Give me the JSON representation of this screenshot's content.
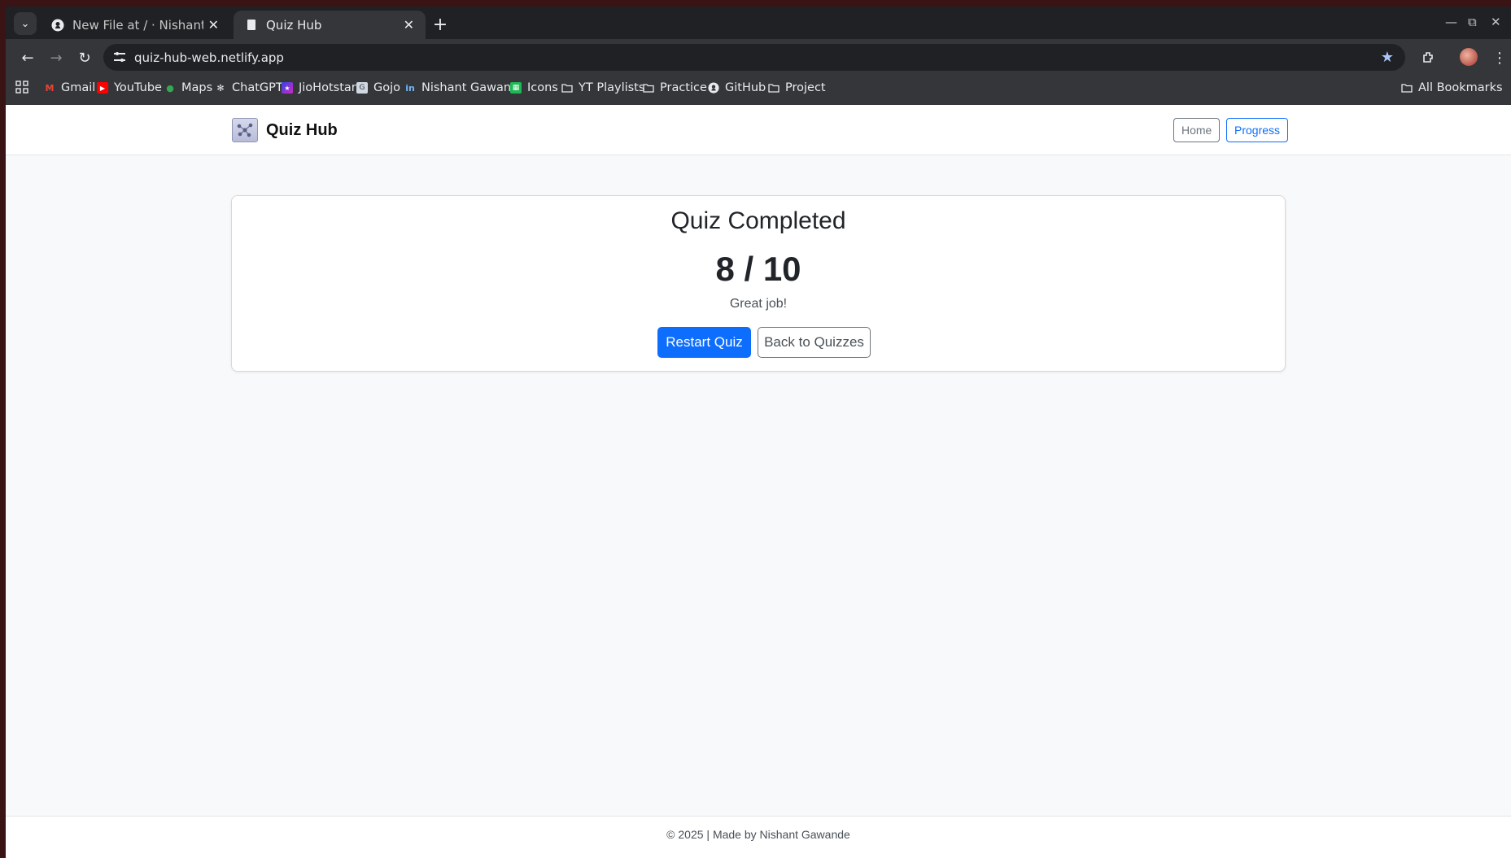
{
  "browser": {
    "tabs": [
      {
        "title": "New File at / · Nishantsg",
        "active": false
      },
      {
        "title": "Quiz Hub",
        "active": true
      }
    ],
    "url": "quiz-hub-web.netlify.app",
    "bookmarks": [
      {
        "label": "Gmail",
        "icon": "gmail-icon"
      },
      {
        "label": "YouTube",
        "icon": "youtube-icon"
      },
      {
        "label": "Maps",
        "icon": "maps-icon"
      },
      {
        "label": "ChatGPT",
        "icon": "chatgpt-icon"
      },
      {
        "label": "JioHotstar",
        "icon": "jiohotstar-icon"
      },
      {
        "label": "Gojo",
        "icon": "gojo-icon"
      },
      {
        "label": "Nishant Gawan...",
        "icon": "linkedin-icon"
      },
      {
        "label": "Icons",
        "icon": "icons-app-icon"
      },
      {
        "label": "YT Playlists",
        "icon": "folder-icon"
      },
      {
        "label": "Practice",
        "icon": "folder-icon"
      },
      {
        "label": "GitHub",
        "icon": "github-icon"
      },
      {
        "label": "Project",
        "icon": "folder-icon"
      }
    ],
    "all_bookmarks": "All Bookmarks"
  },
  "navbar": {
    "brand": "Quiz Hub",
    "home": "Home",
    "progress": "Progress"
  },
  "result": {
    "title": "Quiz Completed",
    "score": "8 / 10",
    "message": "Great job!",
    "restart": "Restart Quiz",
    "back": "Back to Quizzes"
  },
  "footer": {
    "text": "© 2025 | Made by Nishant Gawande"
  },
  "colors": {
    "primary": "#0d6efd",
    "secondary": "#6c757d",
    "page_bg": "#f8f9fa"
  }
}
